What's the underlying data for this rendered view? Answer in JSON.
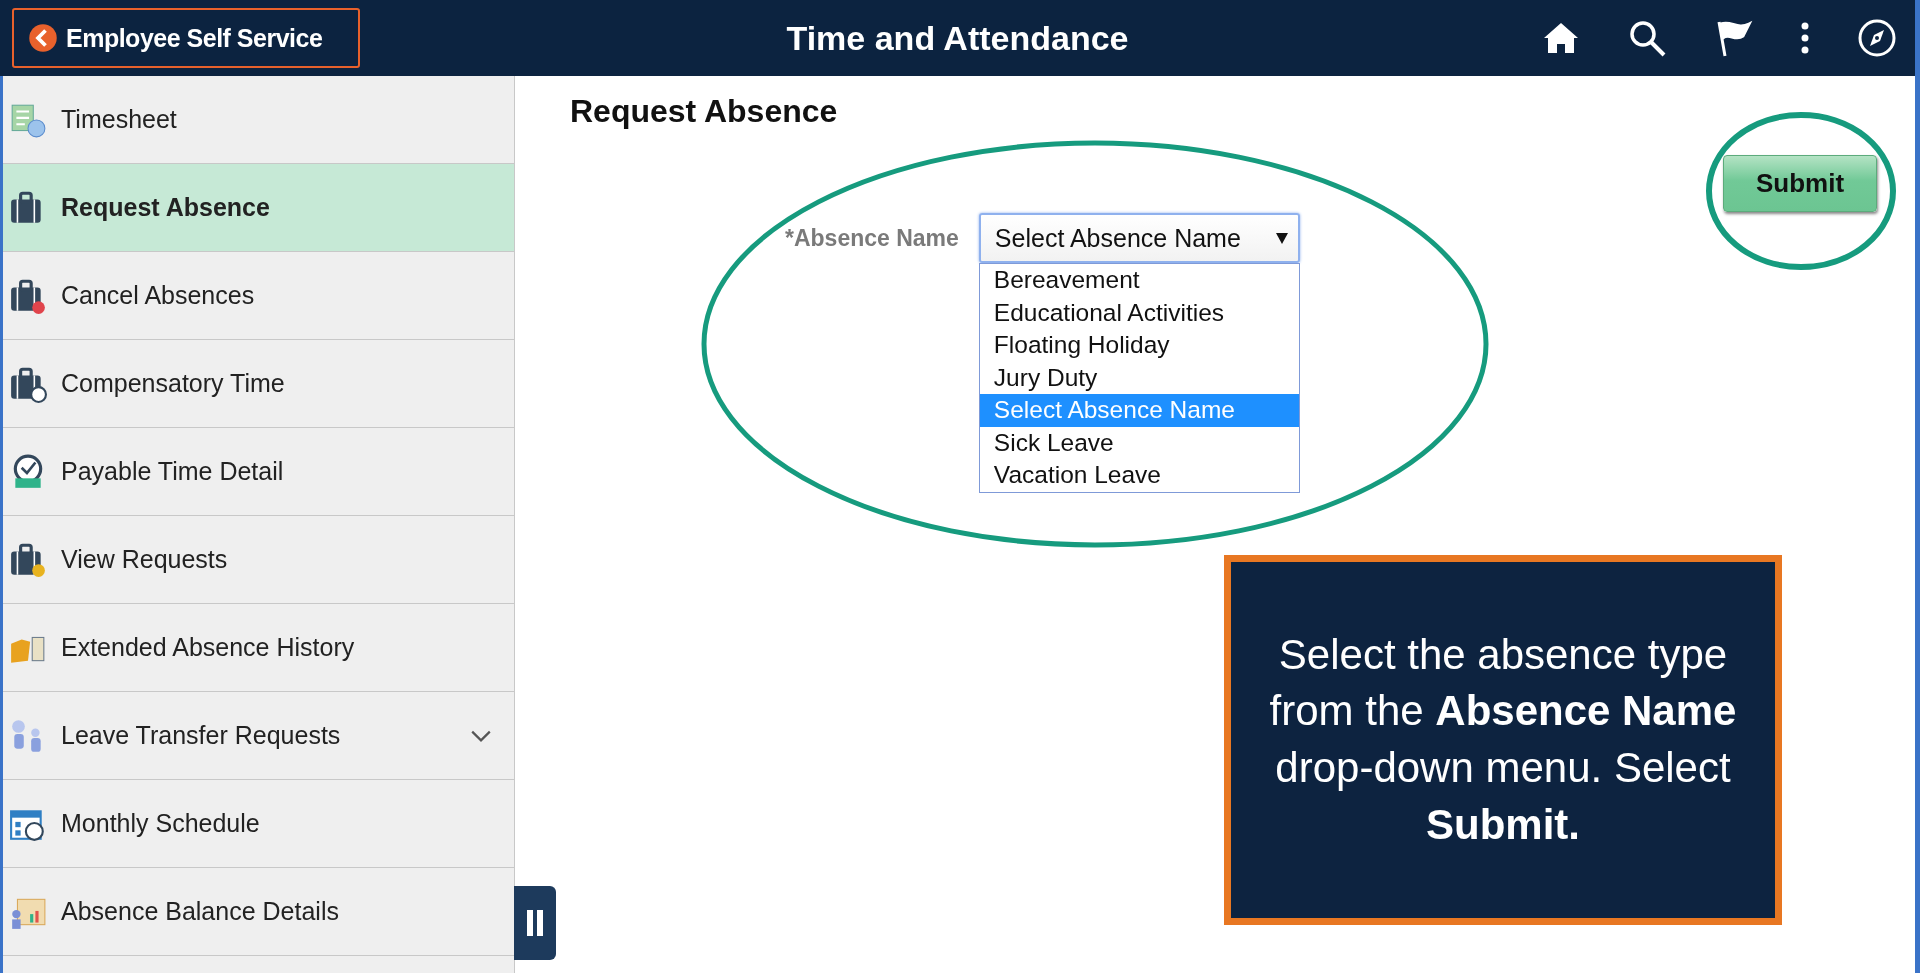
{
  "header": {
    "back_button": "Employee Self Service",
    "title": "Time and Attendance"
  },
  "sidebar": {
    "items": [
      {
        "label": "Timesheet",
        "selected": false,
        "kind": "link"
      },
      {
        "label": "Request Absence",
        "selected": true,
        "kind": "link"
      },
      {
        "label": "Cancel Absences",
        "selected": false,
        "kind": "link"
      },
      {
        "label": "Compensatory Time",
        "selected": false,
        "kind": "link"
      },
      {
        "label": "Payable Time Detail",
        "selected": false,
        "kind": "link"
      },
      {
        "label": "View Requests",
        "selected": false,
        "kind": "link"
      },
      {
        "label": "Extended Absence History",
        "selected": false,
        "kind": "link"
      },
      {
        "label": "Leave Transfer Requests",
        "selected": false,
        "kind": "group"
      },
      {
        "label": "Monthly Schedule",
        "selected": false,
        "kind": "link"
      },
      {
        "label": "Absence Balance Details",
        "selected": false,
        "kind": "link"
      }
    ]
  },
  "main": {
    "page_title": "Request Absence",
    "submit_button": "Submit",
    "field": {
      "label": "*Absence Name",
      "value": "Select Absence Name",
      "expanded": true,
      "options": [
        {
          "label": "Bereavement",
          "selected": false
        },
        {
          "label": "Educational Activities",
          "selected": false
        },
        {
          "label": "Floating Holiday",
          "selected": false
        },
        {
          "label": "Jury Duty",
          "selected": false
        },
        {
          "label": "Select Absence Name",
          "selected": true
        },
        {
          "label": "Sick Leave",
          "selected": false
        },
        {
          "label": "Vacation Leave",
          "selected": false
        }
      ]
    }
  },
  "callout": {
    "text": "Select the absence type from the **Absence Name** drop-down menu. Select **Submit.**"
  }
}
